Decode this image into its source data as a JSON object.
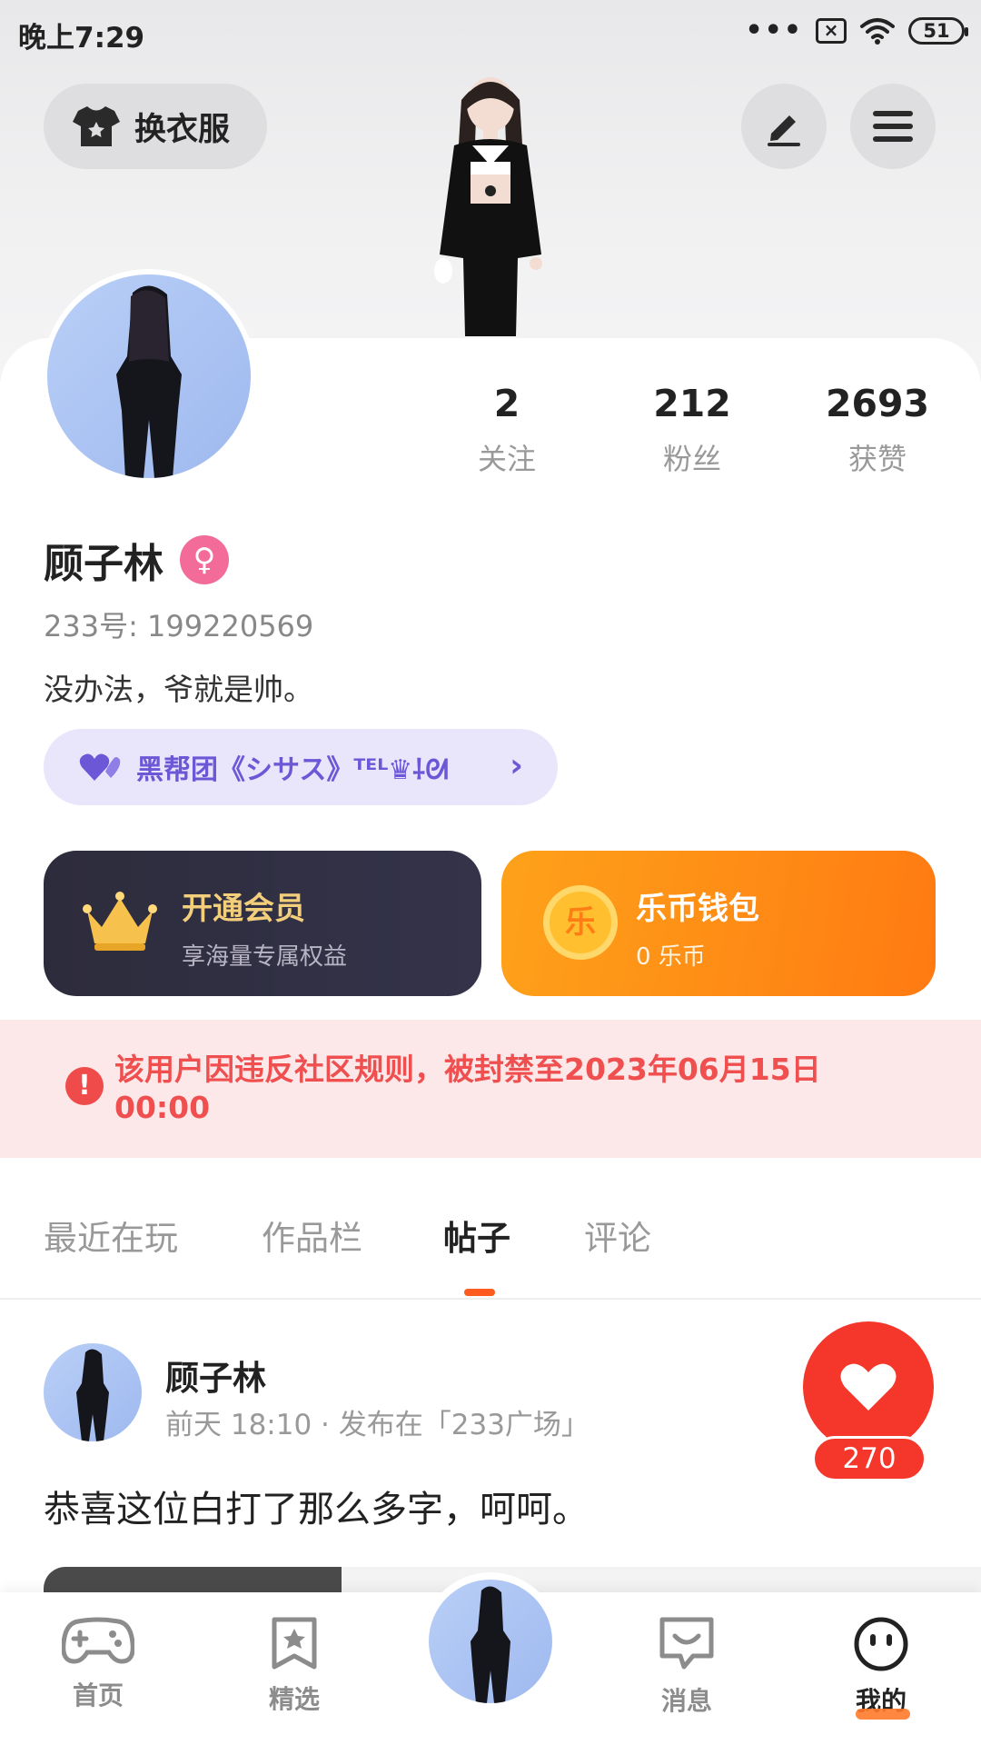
{
  "status_bar": {
    "time": "晚上7:29",
    "dots": "•••",
    "sim_icon": "×",
    "battery": "51"
  },
  "header": {
    "outfit_label": "换衣服",
    "edit_icon": "pen-icon",
    "menu_icon": "menu-icon"
  },
  "profile": {
    "stats": [
      {
        "value": "2",
        "label": "关注"
      },
      {
        "value": "212",
        "label": "粉丝"
      },
      {
        "value": "2693",
        "label": "获赞"
      }
    ],
    "name": "顾子林",
    "gender_symbol": "♀",
    "uid_text": "233号: 199220569",
    "bio": "没办法，爷就是帅。",
    "group_label": "黑帮团《シサス》ᵀᴱᴸ♛⸸ᘛ",
    "group_chevron": "›"
  },
  "cards": {
    "vip": {
      "title": "开通会员",
      "subtitle": "享海量专属权益"
    },
    "wallet": {
      "title": "乐币钱包",
      "subtitle": "0 乐币",
      "coin_text": "乐"
    }
  },
  "ban_notice": {
    "icon": "!",
    "text": "该用户因违反社区规则，被封禁至2023年06月15日 00:00"
  },
  "tabs": [
    "最近在玩",
    "作品栏",
    "帖子",
    "评论"
  ],
  "active_tab": "帖子",
  "post": {
    "author": "顾子林",
    "meta": "前天 18:10 · 发布在「233广场」",
    "text": "恭喜这位白打了那么多字，呵呵。",
    "likes": "270"
  },
  "bottom_nav": [
    {
      "label": "首页",
      "icon": "gamepad-icon"
    },
    {
      "label": "精选",
      "icon": "star-bookmark-icon"
    },
    {
      "label": "",
      "icon": "avatar"
    },
    {
      "label": "消息",
      "icon": "message-icon"
    },
    {
      "label": "我的",
      "icon": "smile-face-icon"
    }
  ],
  "colors": {
    "accent": "#ff5a1f",
    "like": "#f5362a",
    "vip_gold": "#f3cf7c",
    "ban_red": "#ef4f4f",
    "group_purple": "#6c57d6"
  }
}
